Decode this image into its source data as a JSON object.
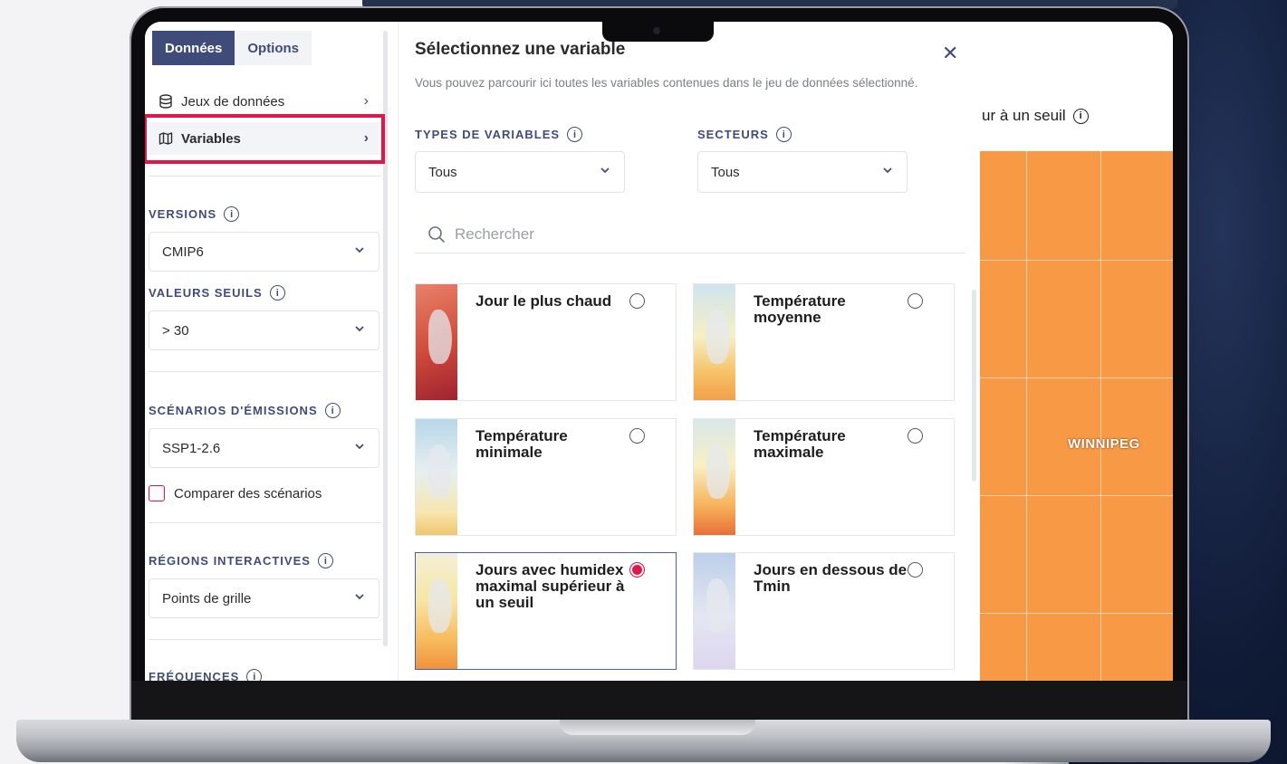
{
  "sidebar": {
    "tabs": [
      {
        "label": "Données",
        "active": true
      },
      {
        "label": "Options",
        "active": false
      }
    ],
    "nav": [
      {
        "label": "Jeux de données",
        "icon": "database-icon"
      },
      {
        "label": "Variables",
        "icon": "map-icon",
        "active": true
      }
    ],
    "versions": {
      "label": "VERSIONS",
      "value": "CMIP6"
    },
    "thresholds": {
      "label": "VALEURS SEUILS",
      "value": "> 30"
    },
    "scenarios": {
      "label": "SCÉNARIOS D'ÉMISSIONS",
      "value": "SSP1-2.6",
      "compare_label": "Comparer des scénarios"
    },
    "regions": {
      "label": "RÉGIONS INTERACTIVES",
      "value": "Points de grille"
    },
    "frequencies": {
      "label": "FRÉQUENCES"
    }
  },
  "modal": {
    "title": "Sélectionnez une variable",
    "description": "Vous pouvez parcourir ici toutes les variables contenues dans le jeu de données sélectionné.",
    "types_label": "TYPES DE VARIABLES",
    "types_value": "Tous",
    "sectors_label": "SECTEURS",
    "sectors_value": "Tous",
    "search_placeholder": "Rechercher",
    "cards": [
      {
        "title": "Jour le plus chaud",
        "selected": false
      },
      {
        "title": "Température moyenne",
        "selected": false
      },
      {
        "title": "Température minimale",
        "selected": false
      },
      {
        "title": "Température maximale",
        "selected": false
      },
      {
        "title": "Jours avec humidex maximal supérieur à un seuil",
        "selected": true
      },
      {
        "title": "Jours en dessous de Tmin",
        "selected": false
      }
    ]
  },
  "map": {
    "title_fragment": "ur à un seuil",
    "city_label": "WINNIPEG",
    "fill_color": "#f89945"
  },
  "colors": {
    "accent": "#3f4c7a",
    "highlight": "#e0174a",
    "selected_radio": "#e0174a"
  }
}
